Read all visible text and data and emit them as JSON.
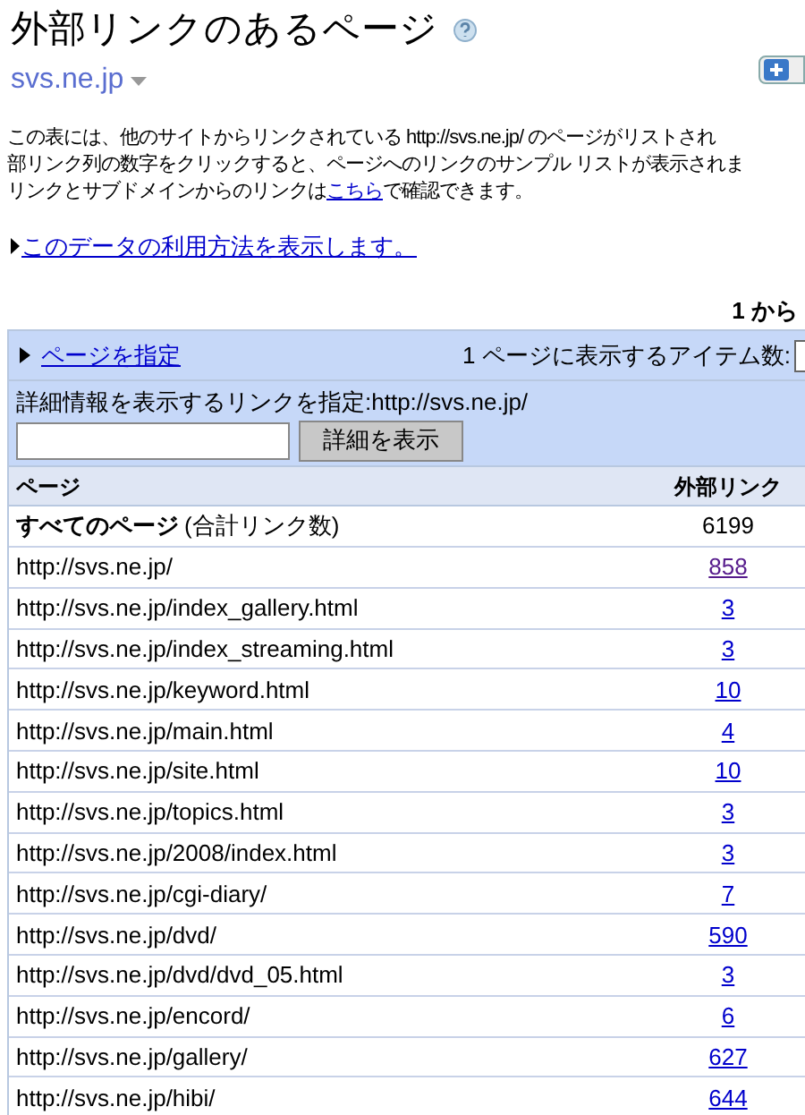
{
  "title": "外部リンクのあるページ",
  "site": "svs.ne.jp",
  "description": [
    "この表には、他のサイトからリンクされている http://svs.ne.jp/ のページがリストされ",
    "部リンク列の数字をクリックすると、ページへのリンクのサンプル リストが表示されま"
  ],
  "description_last": {
    "before": "リンクとサブドメインからのリンクは ",
    "link": "こちら",
    "after": "で確認できます。"
  },
  "usage_link": "このデータの利用方法を表示します。",
  "range": "1 から",
  "page_link": "ページを指定",
  "items_per_page_label": "1 ページに表示するアイテム数:",
  "detail_label": "詳細情報を表示するリンクを指定:http://svs.ne.jp/",
  "detail_button": "詳細を表示",
  "table": {
    "columns": [
      "ページ",
      "外部リンク"
    ],
    "total": {
      "label": "すべてのページ",
      "note": "(合計リンク数)",
      "count": "6199"
    },
    "rows": [
      {
        "page": "http://svs.ne.jp/",
        "links": "858",
        "visited": true
      },
      {
        "page": "http://svs.ne.jp/index_gallery.html",
        "links": "3",
        "visited": false
      },
      {
        "page": "http://svs.ne.jp/index_streaming.html",
        "links": "3",
        "visited": false
      },
      {
        "page": "http://svs.ne.jp/keyword.html",
        "links": "10",
        "visited": false
      },
      {
        "page": "http://svs.ne.jp/main.html",
        "links": "4",
        "visited": false
      },
      {
        "page": "http://svs.ne.jp/site.html",
        "links": "10",
        "visited": false
      },
      {
        "page": "http://svs.ne.jp/topics.html",
        "links": "3",
        "visited": false
      },
      {
        "page": "http://svs.ne.jp/2008/index.html",
        "links": "3",
        "visited": false
      },
      {
        "page": "http://svs.ne.jp/cgi-diary/",
        "links": "7",
        "visited": false
      },
      {
        "page": "http://svs.ne.jp/dvd/",
        "links": "590",
        "visited": false
      },
      {
        "page": "http://svs.ne.jp/dvd/dvd_05.html",
        "links": "3",
        "visited": false
      },
      {
        "page": "http://svs.ne.jp/encord/",
        "links": "6",
        "visited": false
      },
      {
        "page": "http://svs.ne.jp/gallery/",
        "links": "627",
        "visited": false
      },
      {
        "page": "http://svs.ne.jp/hibi/",
        "links": "644",
        "visited": false
      }
    ]
  }
}
